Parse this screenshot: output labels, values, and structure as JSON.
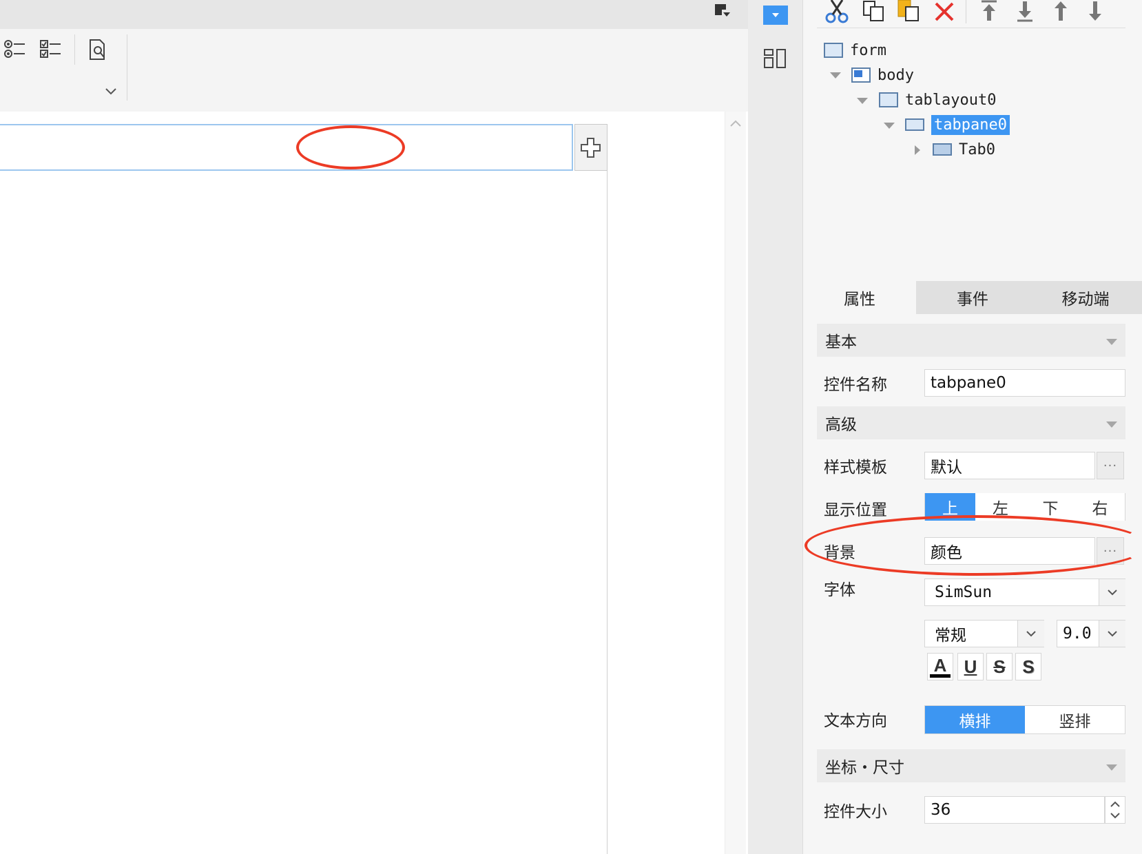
{
  "tree": {
    "items": [
      {
        "label": "form"
      },
      {
        "label": "body"
      },
      {
        "label": "tablayout0"
      },
      {
        "label": "tabpane0"
      },
      {
        "label": "Tab0"
      }
    ]
  },
  "tabs": {
    "properties": "属性",
    "events": "事件",
    "mobile": "移动端"
  },
  "basic": {
    "title": "基本",
    "name_label": "控件名称",
    "name_value": "tabpane0"
  },
  "advanced": {
    "title": "高级",
    "style_label": "样式模板",
    "style_value": "默认",
    "position_label": "显示位置",
    "positions": [
      "上",
      "左",
      "下",
      "右"
    ],
    "background_label": "背景",
    "background_value": "颜色",
    "font_label": "字体",
    "font_value": "SimSun",
    "font_style_value": "常规",
    "font_size_value": "9.0",
    "format_buttons": [
      "A",
      "U",
      "S",
      "S"
    ],
    "text_dir_label": "文本方向",
    "text_dir_options": [
      "横排",
      "竖排"
    ]
  },
  "coords": {
    "title": "坐标・尺寸",
    "size_label": "控件大小",
    "size_value": "36"
  },
  "colors": {
    "accent": "#3d96f2",
    "annotation": "#ec3b25",
    "delete": "#e5322d"
  }
}
